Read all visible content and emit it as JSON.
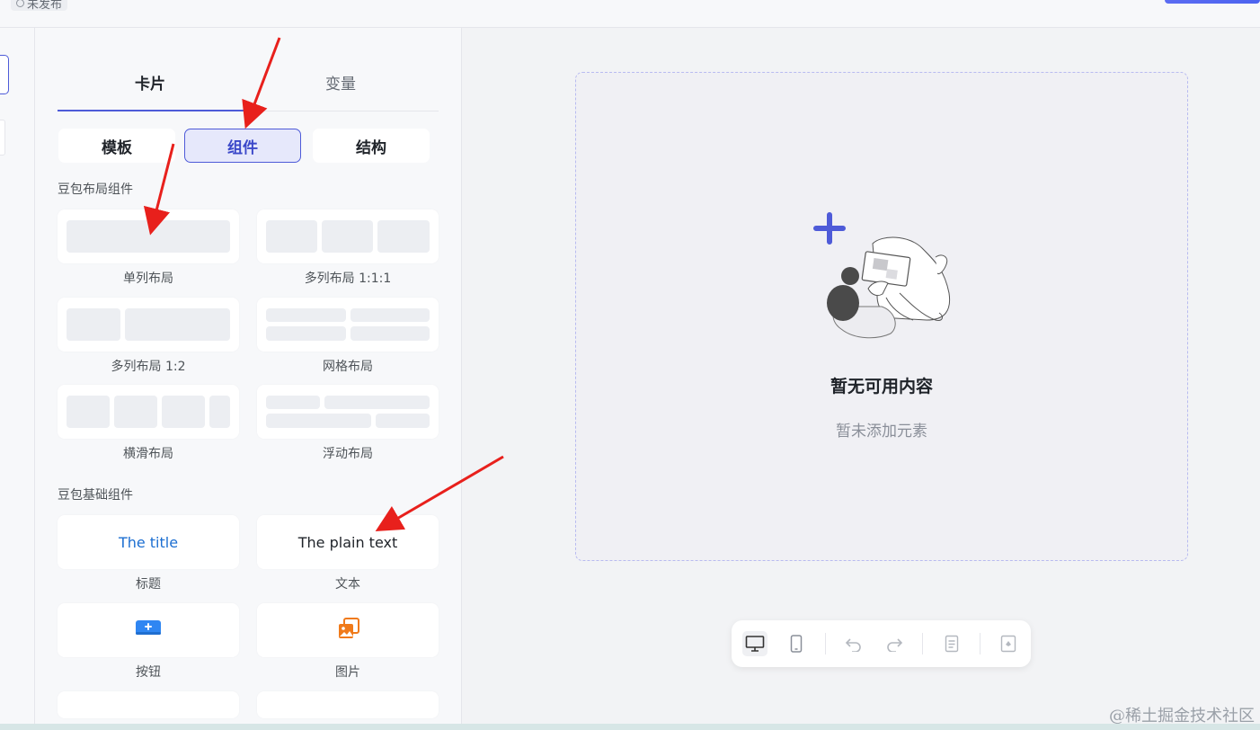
{
  "header": {
    "status": "未发布"
  },
  "panel": {
    "tabs": [
      {
        "label": "卡片"
      },
      {
        "label": "变量"
      }
    ],
    "segments": [
      {
        "label": "模板"
      },
      {
        "label": "组件"
      },
      {
        "label": "结构"
      }
    ],
    "layout_section": {
      "title": "豆包布局组件",
      "items": [
        {
          "label": "单列布局"
        },
        {
          "label": "多列布局 1:1:1"
        },
        {
          "label": "多列布局 1:2"
        },
        {
          "label": "网格布局"
        },
        {
          "label": "横滑布局"
        },
        {
          "label": "浮动布局"
        }
      ]
    },
    "basic_section": {
      "title": "豆包基础组件",
      "items": [
        {
          "label": "标题",
          "preview": "The title"
        },
        {
          "label": "文本",
          "preview": "The plain text"
        },
        {
          "label": "按钮"
        },
        {
          "label": "图片"
        }
      ]
    }
  },
  "canvas": {
    "empty_title": "暂无可用内容",
    "empty_subtitle": "暂未添加元素"
  },
  "watermark": "@稀土掘金技术社区",
  "colors": {
    "accent": "#4e5bd8",
    "title_blue": "#1d6fd1",
    "image_orange": "#f07a1a",
    "arrow_red": "#e8201c"
  }
}
